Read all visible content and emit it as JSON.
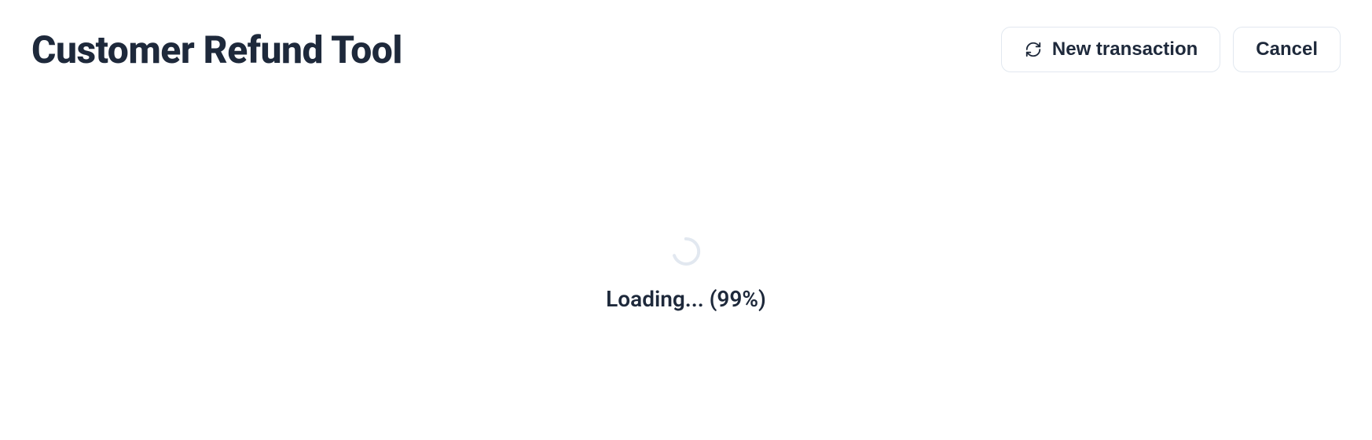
{
  "header": {
    "title": "Customer Refund Tool",
    "buttons": {
      "new_transaction": "New transaction",
      "cancel": "Cancel"
    }
  },
  "loading": {
    "text": "Loading... (99%)"
  }
}
